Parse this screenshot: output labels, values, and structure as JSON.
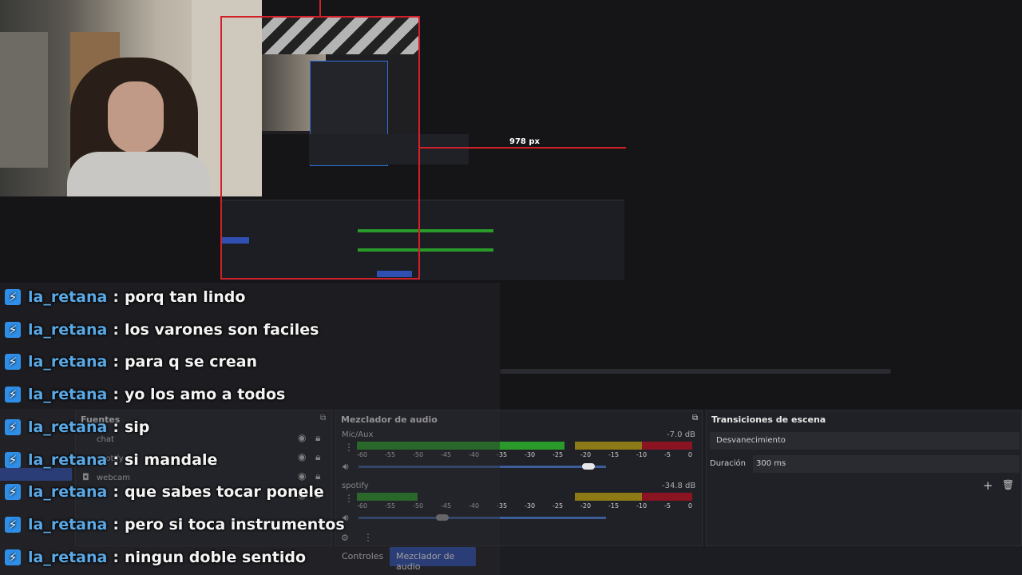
{
  "measure_label": "978 px",
  "chat": [
    {
      "user": "la_retana",
      "sep": ":",
      "text": "porq tan lindo"
    },
    {
      "user": "la_retana",
      "sep": ":",
      "text": "los varones son faciles"
    },
    {
      "user": "la_retana",
      "sep": ":",
      "text": "para q se crean"
    },
    {
      "user": "la_retana",
      "sep": ":",
      "text": "yo los amo a todos"
    },
    {
      "user": "la_retana",
      "sep": ":",
      "text": "sip"
    },
    {
      "user": "la_retana",
      "sep": ":",
      "text": "si mandale"
    },
    {
      "user": "la_retana",
      "sep": ":",
      "text": "que sabes tocar ponele"
    },
    {
      "user": "la_retana",
      "sep": ":",
      "text": "pero si toca instrumentos"
    },
    {
      "user": "la_retana",
      "sep": ":",
      "text": "ningun doble sentido"
    }
  ],
  "sources": {
    "title": "Fuentes",
    "items": [
      {
        "name": "chat"
      },
      {
        "name": "spotify"
      },
      {
        "name": "webcam"
      }
    ]
  },
  "mixer": {
    "title": "Mezclador de audio",
    "channels": [
      {
        "name": "Mic/Aux",
        "db": "-7.0 dB",
        "level": 0.62,
        "volume": 0.93
      },
      {
        "name": "spotify",
        "db": "-34.8 dB",
        "level": 0.18,
        "volume": 0.34
      }
    ],
    "ticks": [
      "-60",
      "-55",
      "-50",
      "-45",
      "-40",
      "-35",
      "-30",
      "-25",
      "-20",
      "-15",
      "-10",
      "-5",
      "0"
    ]
  },
  "transitions": {
    "title": "Transiciones de escena",
    "selected": "Desvanecimiento",
    "duration_label": "Duración",
    "duration_value": "300 ms"
  },
  "tabs": {
    "controls": "Controles",
    "mixer": "Mezclador de audio"
  },
  "colors": {
    "accent": "#2f4fb2",
    "username": "#5aa9e6",
    "badge": "#2f8fe8",
    "guide": "#d0202a"
  }
}
